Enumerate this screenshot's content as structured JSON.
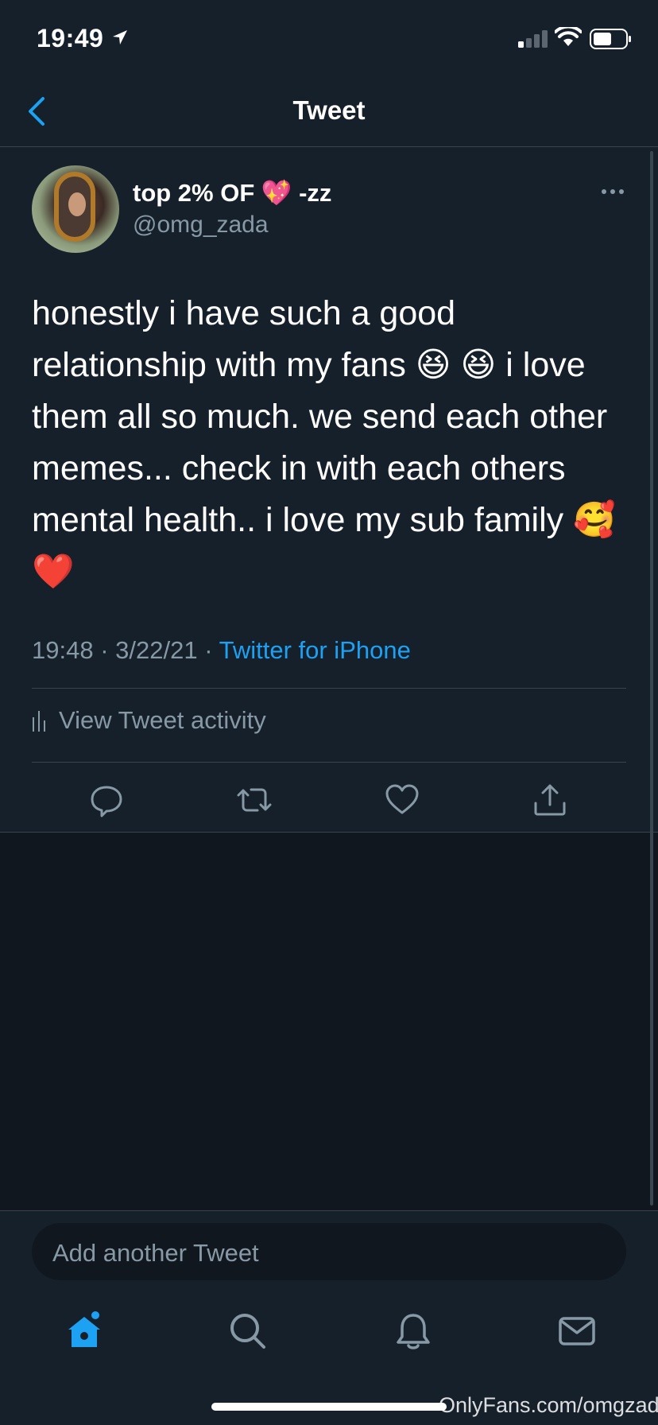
{
  "status_bar": {
    "time": "19:49"
  },
  "nav": {
    "title": "Tweet"
  },
  "tweet": {
    "display_name": "top 2% OF 💖 -zz",
    "handle": "@omg_zada",
    "text": "honestly i have such a good relationship with my fans 😆 😆  i love them all so much. we send each other memes... check in with each others mental health.. i love my sub family 🥰 ❤️",
    "time": "19:48",
    "date": "3/22/21",
    "source": "Twitter for iPhone",
    "separator": "·"
  },
  "activity": {
    "label": "View Tweet activity"
  },
  "compose": {
    "placeholder": "Add another Tweet"
  },
  "tabs": [
    "home-icon",
    "search-icon",
    "bell-icon",
    "mail-icon"
  ],
  "watermark": "OnlyFans.com/omgzada",
  "colors": {
    "background": "#15202b",
    "accent": "#1da1f2",
    "muted": "#8899a6",
    "divider": "#38444d"
  }
}
